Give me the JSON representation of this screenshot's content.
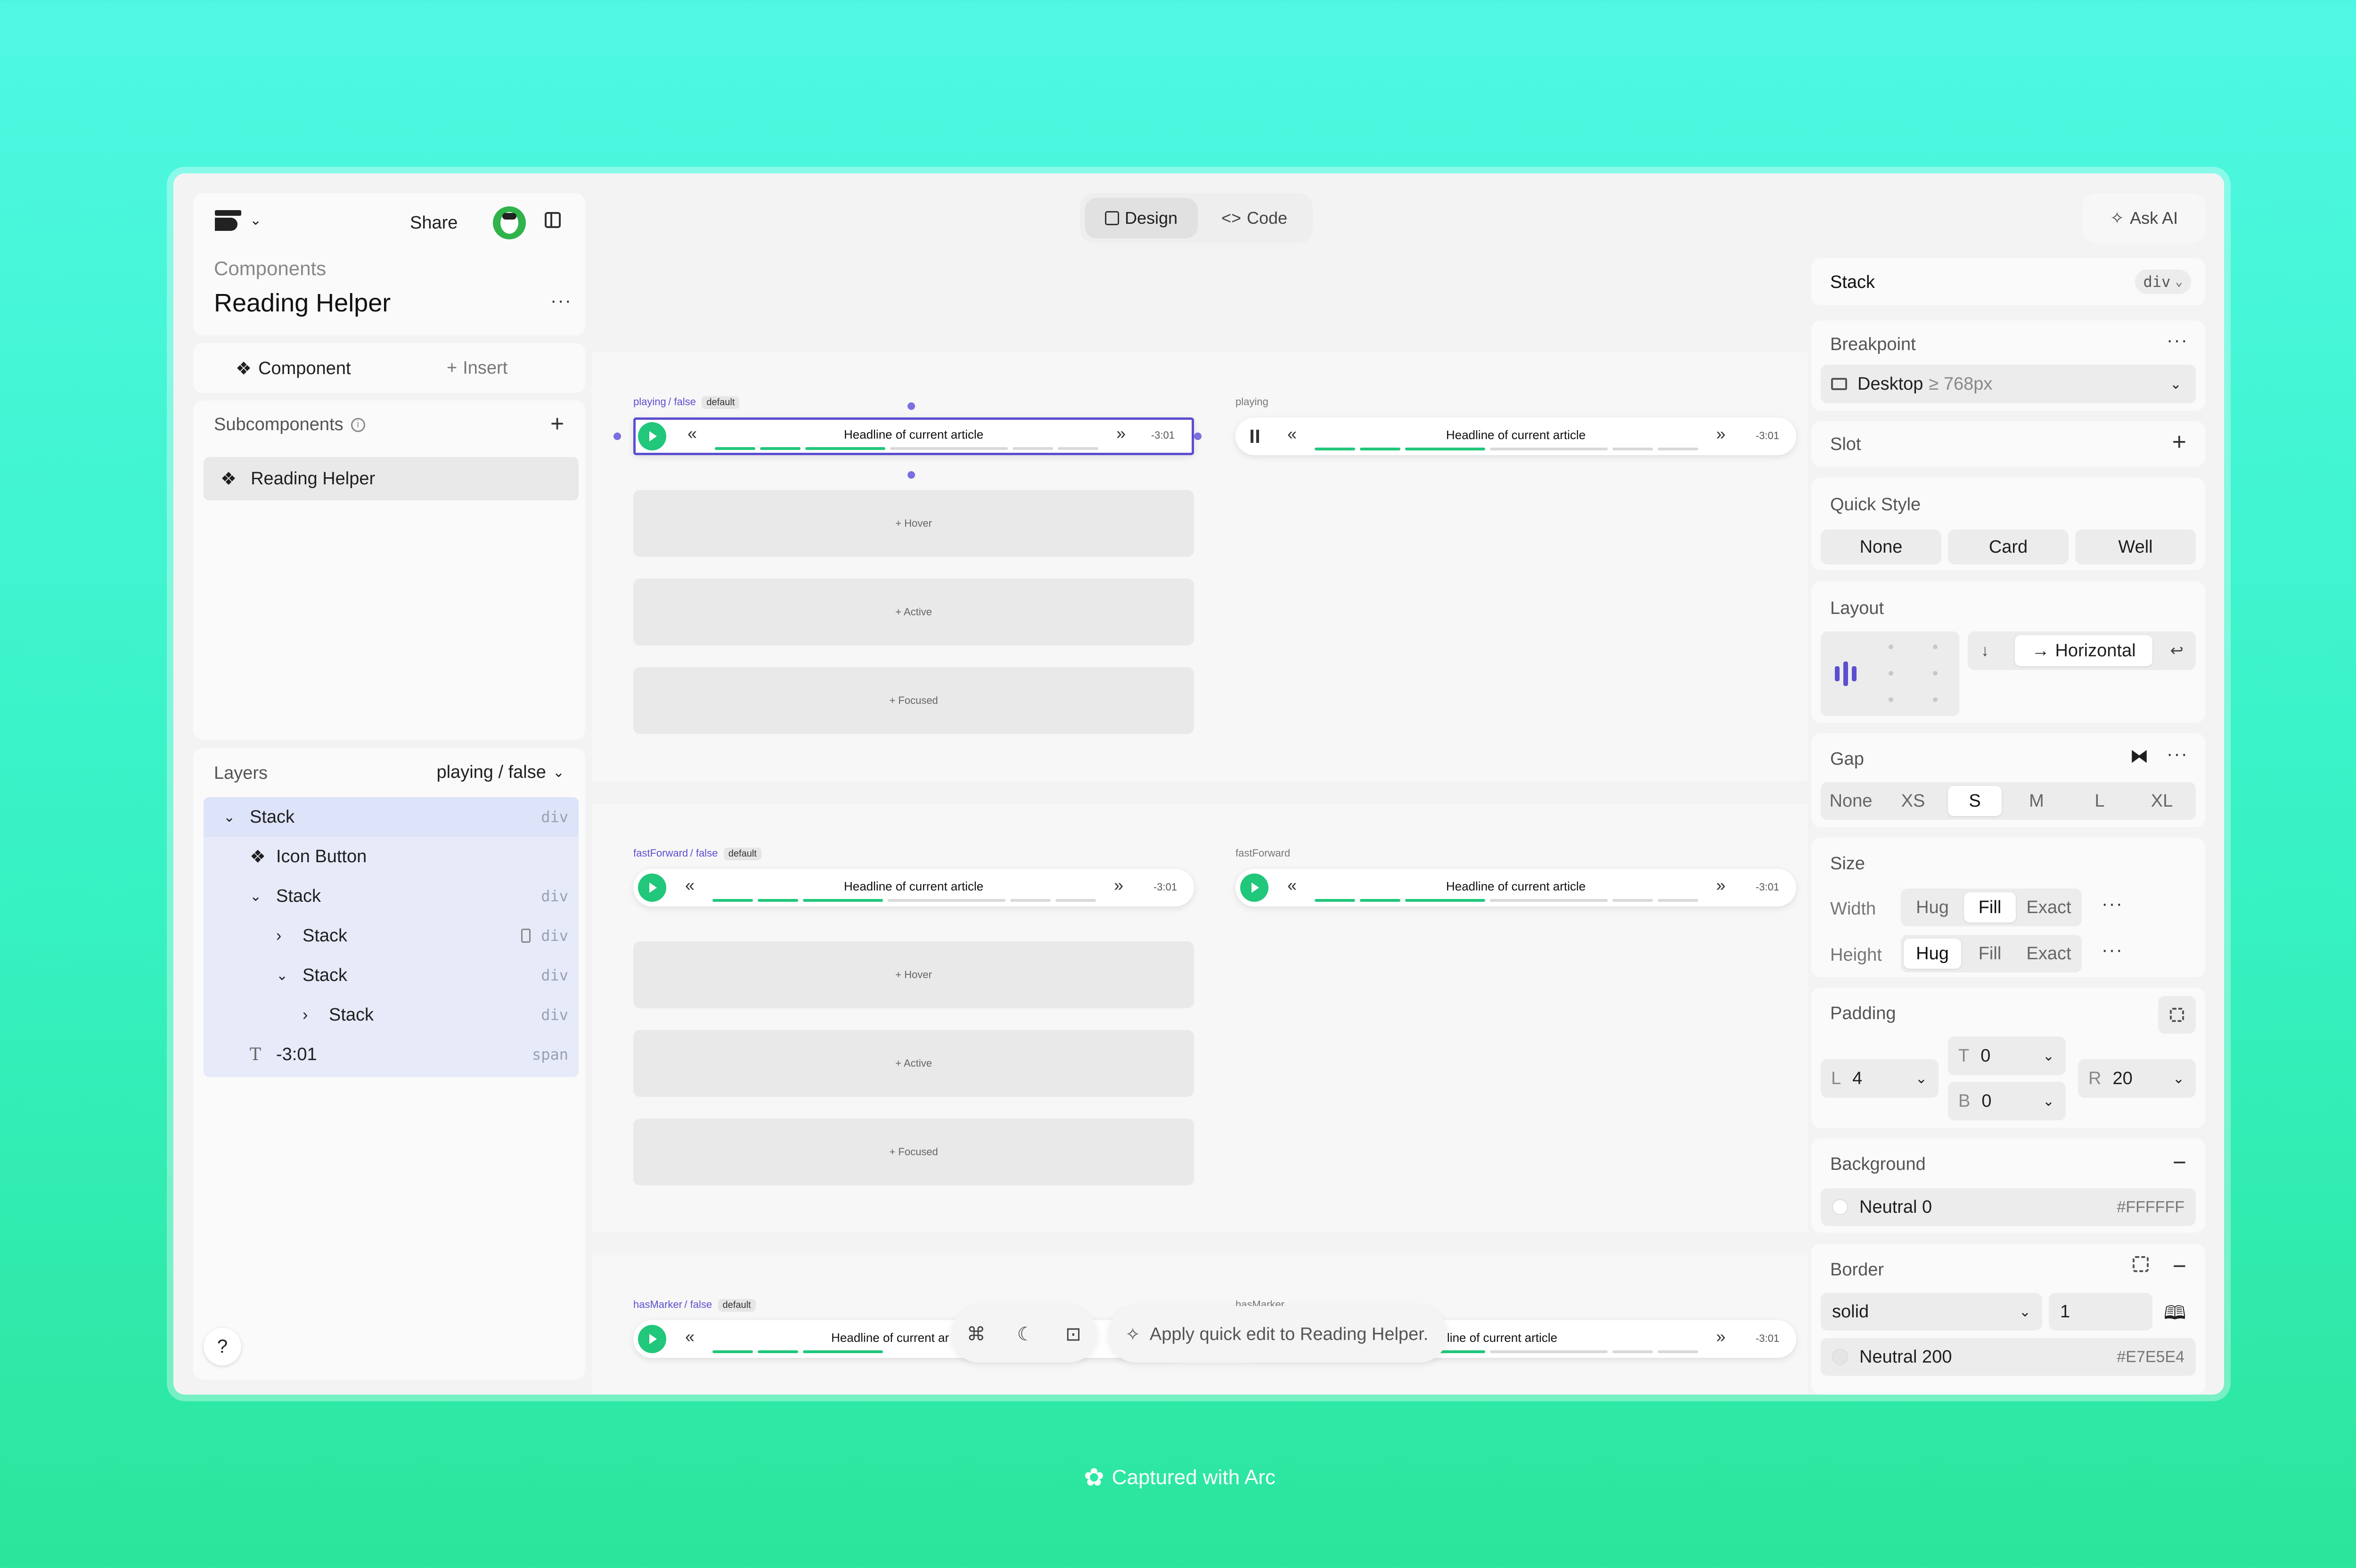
{
  "header": {
    "share_label": "Share",
    "tabs": [
      {
        "label": "Design"
      },
      {
        "label": "Code"
      }
    ],
    "ask_ai_label": "Ask AI"
  },
  "project": {
    "breadcrumb": "Components",
    "title": "Reading Helper"
  },
  "sidebar": {
    "component_tab": "Component",
    "insert_tab": "Insert",
    "subcomponents_title": "Subcomponents",
    "subcomponents": [
      {
        "label": "Reading Helper"
      }
    ],
    "layers_title": "Layers",
    "layers_variant": "playing / false",
    "layers": [
      {
        "label": "Stack",
        "tag": "div"
      },
      {
        "label": "Icon Button",
        "tag": ""
      },
      {
        "label": "Stack",
        "tag": "div"
      },
      {
        "label": "Stack",
        "tag": "div"
      },
      {
        "label": "Stack",
        "tag": "div"
      },
      {
        "label": "Stack",
        "tag": "div"
      },
      {
        "label": "-3:01",
        "tag": "span"
      }
    ],
    "help_label": "?"
  },
  "canvas": {
    "sections": [
      {
        "variant": "playing",
        "suffix": "/ false",
        "badge": "default",
        "alt_label": "playing"
      },
      {
        "variant": "fastForward",
        "suffix": "/ false",
        "badge": "default",
        "alt_label": "fastForward"
      },
      {
        "variant": "hasMarker",
        "suffix": "/ false",
        "badge": "default",
        "alt_label": "hasMarker"
      }
    ],
    "player": {
      "title": "Headline of current article",
      "time": "-3:01",
      "title_cut": "Headline of current ar",
      "title_cut2": "adline of current article"
    },
    "states": [
      "+ Hover",
      "+ Active",
      "+ Focused"
    ]
  },
  "toolbar": {
    "quick_edit": "Apply quick edit to Reading Helper."
  },
  "inspector": {
    "element_name": "Stack",
    "element_tag": "div",
    "breakpoint_title": "Breakpoint",
    "breakpoint_value": "Desktop",
    "breakpoint_hint": "≥ 768px",
    "slot_title": "Slot",
    "quick_style_title": "Quick Style",
    "quick_styles": [
      "None",
      "Card",
      "Well"
    ],
    "layout_title": "Layout",
    "layout_direction": "Horizontal",
    "gap_title": "Gap",
    "gap_options": [
      "None",
      "XS",
      "S",
      "M",
      "L",
      "XL"
    ],
    "gap_selected": "S",
    "size_title": "Size",
    "width_label": "Width",
    "height_label": "Height",
    "size_options": [
      "Hug",
      "Fill",
      "Exact"
    ],
    "width_selected": "Fill",
    "height_selected": "Hug",
    "padding_title": "Padding",
    "padding": {
      "L": "4",
      "T": "0",
      "B": "0",
      "R": "20"
    },
    "background_title": "Background",
    "background_name": "Neutral 0",
    "background_hex": "#FFFFFF",
    "border_title": "Border",
    "border_style": "solid",
    "border_width": "1",
    "border_color_name": "Neutral 200",
    "border_color_hex": "#E7E5E4"
  },
  "footer": {
    "captured": "Captured with Arc"
  },
  "colors": {
    "accent": "#5b4fcf",
    "play": "#21c77a",
    "selection": "#e4e8fb"
  }
}
